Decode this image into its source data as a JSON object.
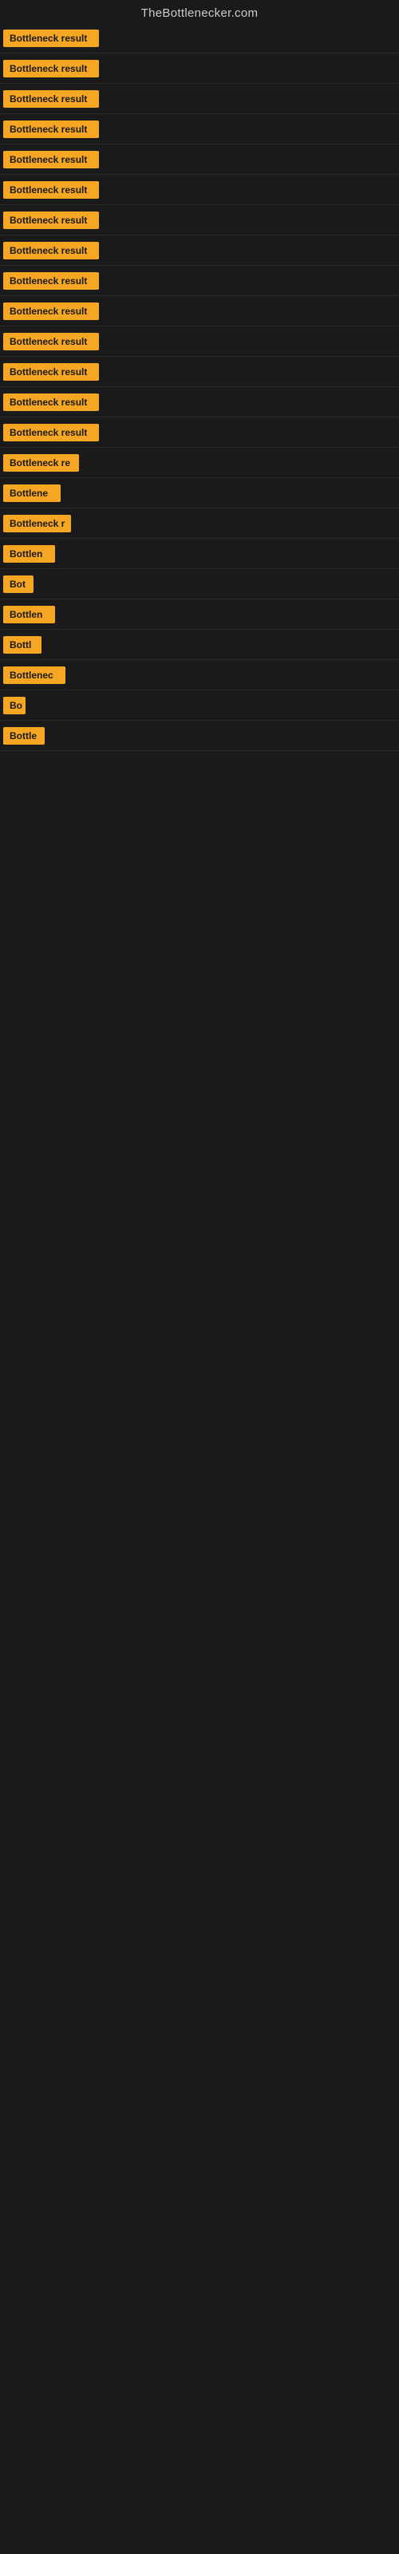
{
  "site": {
    "title": "TheBottlenecker.com"
  },
  "colors": {
    "badge_bg": "#f5a623",
    "page_bg": "#1a1a1a"
  },
  "rows": [
    {
      "id": 1,
      "label": "Bottleneck result",
      "width": 120
    },
    {
      "id": 2,
      "label": "Bottleneck result",
      "width": 120
    },
    {
      "id": 3,
      "label": "Bottleneck result",
      "width": 120
    },
    {
      "id": 4,
      "label": "Bottleneck result",
      "width": 120
    },
    {
      "id": 5,
      "label": "Bottleneck result",
      "width": 120
    },
    {
      "id": 6,
      "label": "Bottleneck result",
      "width": 120
    },
    {
      "id": 7,
      "label": "Bottleneck result",
      "width": 120
    },
    {
      "id": 8,
      "label": "Bottleneck result",
      "width": 120
    },
    {
      "id": 9,
      "label": "Bottleneck result",
      "width": 120
    },
    {
      "id": 10,
      "label": "Bottleneck result",
      "width": 120
    },
    {
      "id": 11,
      "label": "Bottleneck result",
      "width": 120
    },
    {
      "id": 12,
      "label": "Bottleneck result",
      "width": 120
    },
    {
      "id": 13,
      "label": "Bottleneck result",
      "width": 120
    },
    {
      "id": 14,
      "label": "Bottleneck result",
      "width": 120
    },
    {
      "id": 15,
      "label": "Bottleneck re",
      "width": 95
    },
    {
      "id": 16,
      "label": "Bottlene",
      "width": 72
    },
    {
      "id": 17,
      "label": "Bottleneck r",
      "width": 85
    },
    {
      "id": 18,
      "label": "Bottlen",
      "width": 65
    },
    {
      "id": 19,
      "label": "Bot",
      "width": 38
    },
    {
      "id": 20,
      "label": "Bottlen",
      "width": 65
    },
    {
      "id": 21,
      "label": "Bottl",
      "width": 48
    },
    {
      "id": 22,
      "label": "Bottlenec",
      "width": 78
    },
    {
      "id": 23,
      "label": "Bo",
      "width": 28
    },
    {
      "id": 24,
      "label": "Bottle",
      "width": 52
    }
  ]
}
